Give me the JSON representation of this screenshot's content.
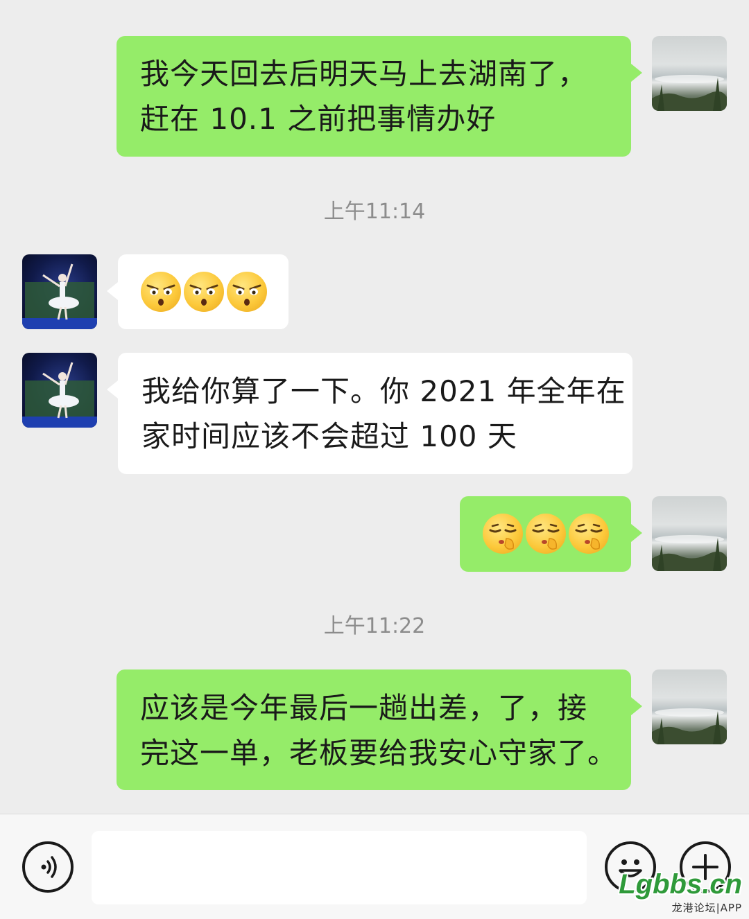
{
  "messages": [
    {
      "side": "right",
      "type": "text",
      "lines": [
        "我今天回去后明天马上去湖南了，",
        "赶在 10.1 之前把事情办好"
      ]
    },
    {
      "side": "left",
      "type": "emoji",
      "emoji": [
        "glaring-face",
        "glaring-face",
        "glaring-face"
      ]
    },
    {
      "side": "left",
      "type": "text",
      "lines": [
        "我给你算了一下。你 2021 年全年在",
        "家时间应该不会超过 100 天"
      ]
    },
    {
      "side": "right",
      "type": "emoji",
      "emoji": [
        "shushing-face",
        "shushing-face",
        "shushing-face"
      ]
    },
    {
      "side": "right",
      "type": "text",
      "lines": [
        "应该是今年最后一趟出差，了，接",
        "完这一单，老板要给我安心守家了。"
      ]
    }
  ],
  "timestamps": [
    "上午11:14",
    "上午11:22"
  ],
  "input": {
    "value": "",
    "voice_icon": "voice-icon",
    "emoji_icon": "emoji-icon",
    "plus_icon": "plus-icon"
  },
  "watermark": {
    "logo": "Lgbbs.cn",
    "sub": "龙港论坛|APP"
  },
  "colors": {
    "background": "#ededed",
    "sent_bubble": "#95ec69",
    "received_bubble": "#ffffff",
    "timestamp": "#8c8c8c"
  }
}
